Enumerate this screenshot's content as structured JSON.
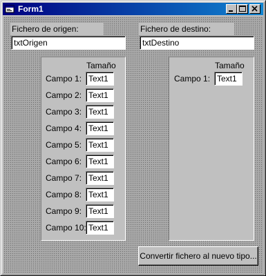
{
  "window": {
    "title": "Form1",
    "minimize_glyph": "_",
    "maximize_glyph": "□",
    "close_glyph": "×",
    "icon": "vb-form-icon"
  },
  "origen": {
    "label": "Fichero de origen:",
    "textbox_value": "txtOrigen",
    "size_header": "Tamaño",
    "fields": [
      {
        "label": "Campo 1:",
        "value": "Text1"
      },
      {
        "label": "Campo 2:",
        "value": "Text1"
      },
      {
        "label": "Campo 3:",
        "value": "Text1"
      },
      {
        "label": "Campo 4:",
        "value": "Text1"
      },
      {
        "label": "Campo 5:",
        "value": "Text1"
      },
      {
        "label": "Campo 6:",
        "value": "Text1"
      },
      {
        "label": "Campo 7:",
        "value": "Text1"
      },
      {
        "label": "Campo 8:",
        "value": "Text1"
      },
      {
        "label": "Campo 9:",
        "value": "Text1"
      },
      {
        "label": "Campo 10:",
        "value": "Text1"
      }
    ]
  },
  "destino": {
    "label": "Fichero de destino:",
    "textbox_value": "txtDestino",
    "size_header": "Tamaño",
    "fields": [
      {
        "label": "Campo 1:",
        "value": "Text1"
      }
    ]
  },
  "convert_button": {
    "label": "Convertir fichero al nuevo tipo..."
  }
}
